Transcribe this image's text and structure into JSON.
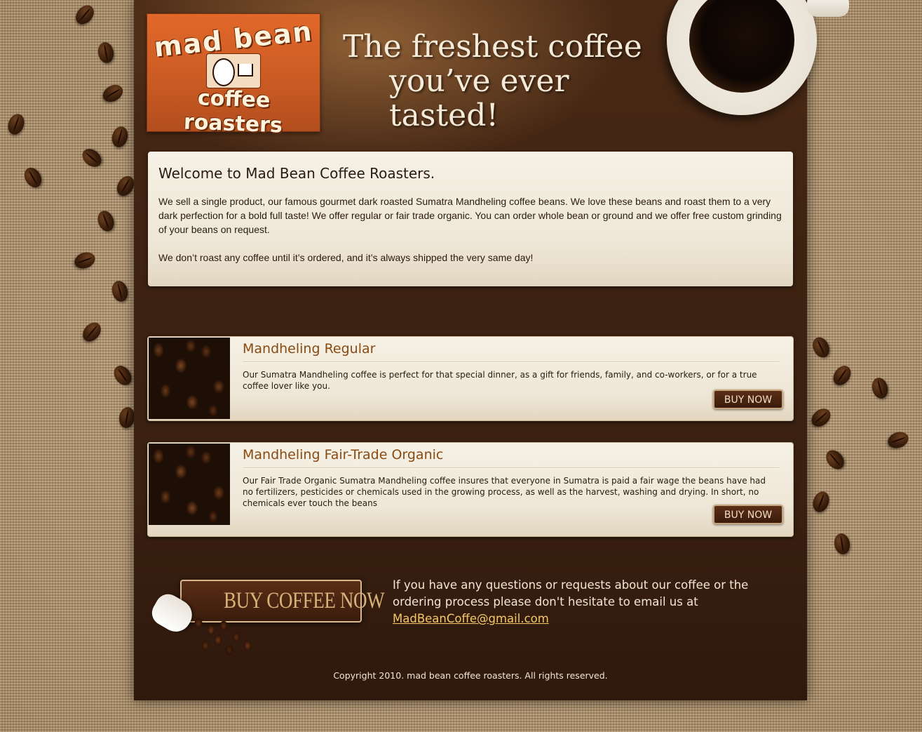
{
  "brand": {
    "logo_line1": "mad bean",
    "logo_line2": "coffee roasters"
  },
  "header": {
    "tagline_line1": "The freshest coffee",
    "tagline_line2": "you’ve ever tasted!"
  },
  "welcome": {
    "title": "Welcome to Mad Bean Coffee Roasters.",
    "paragraph1": "We sell a single product, our famous gourmet dark roasted Sumatra Mandheling coffee beans.  We love these beans and roast them to a very dark perfection for a bold full taste!  We offer regular or fair trade organic.  You can order whole bean or ground and we offer free custom grinding of your beans on request.",
    "paragraph2": "We don’t roast any coffee until it’s ordered, and it’s always shipped the very same day!"
  },
  "products": [
    {
      "title": "Mandheling Regular",
      "description": "Our Sumatra Mandheling coffee is perfect for that special dinner, as a gift for friends, family, and co-workers, or for a true coffee lover like you.",
      "button_label": "BUY NOW"
    },
    {
      "title": "Mandheling Fair-Trade Organic",
      "description": "Our Fair Trade Organic Sumatra Mandheling coffee insures that everyone in Sumatra is paid a fair wage the beans have had no fertilizers, pesticides or chemicals used in the growing process, as well as the harvest, washing and drying. In short, no chemicals ever touch the beans",
      "button_label": "BUY NOW"
    }
  ],
  "cta": {
    "label": "BUY COFFEE NOW"
  },
  "contact": {
    "text": "If you have any questions or requests about our coffee or the ordering process please don't hesitate to email us at",
    "email": "MadBeanCoffe@gmail.com"
  },
  "footer": {
    "copyright": "Copyright 2010. mad bean coffee roasters. All rights reserved."
  },
  "colors": {
    "page_background": "#3d2212",
    "accent": "#8a4a12",
    "link": "#f4c86a",
    "logo_orange": "#e2682a"
  }
}
